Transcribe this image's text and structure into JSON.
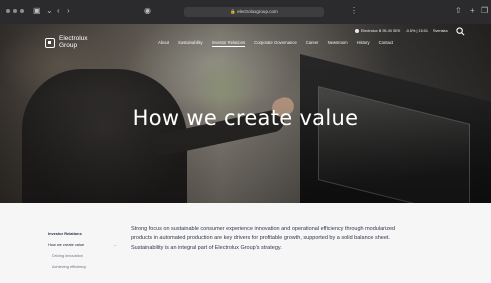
{
  "browser": {
    "url": "electroluxgroup.com"
  },
  "site": {
    "logo_line1": "Electrolux",
    "logo_line2": "Group",
    "nav": [
      "About",
      "Sustainability",
      "Investor Relations",
      "Corporate Governance",
      "Career",
      "Newsroom",
      "History",
      "Contact"
    ],
    "nav_active": "Investor Relations",
    "share_price": "Electrolux B 95.40 SEK",
    "share_change": "-0.5% | 15:01",
    "language": "Svenska"
  },
  "hero": {
    "title": "How we create value"
  },
  "sidebar": {
    "items": [
      {
        "label": "Investor Relations"
      },
      {
        "label": "How we create value"
      },
      {
        "label": "Driving innovation"
      },
      {
        "label": "Achieving efficiency"
      }
    ]
  },
  "main": {
    "intro": "Strong focus on sustainable consumer experience innovation and operational efficiency through modularized products in automated production are key drivers for profitable growth, supported by a solid balance sheet. Sustainability is an integral part of Electrolux Group's strategy."
  },
  "colors": {
    "chrome_bg": "#2b2b2d",
    "page_bg": "#f6f6f6",
    "text_navy": "#20283f"
  }
}
